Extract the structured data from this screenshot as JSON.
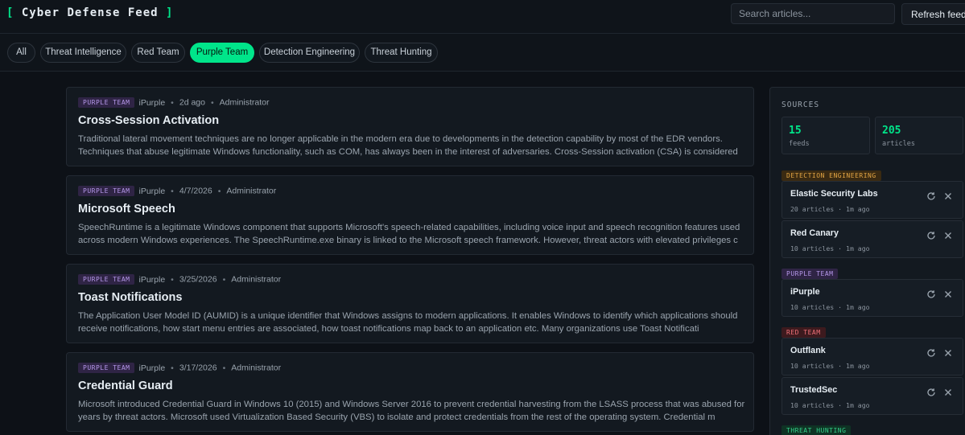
{
  "app": {
    "title_left": "[",
    "title": " Cyber Defense Feed ",
    "title_right": "]"
  },
  "header": {
    "search_placeholder": "Search articles...",
    "refresh_label": "Refresh feeds"
  },
  "tabs": [
    {
      "label": "All",
      "active": false
    },
    {
      "label": "Threat Intelligence",
      "active": false
    },
    {
      "label": "Red Team",
      "active": false
    },
    {
      "label": "Purple Team",
      "active": true
    },
    {
      "label": "Detection Engineering",
      "active": false
    },
    {
      "label": "Threat Hunting",
      "active": false
    }
  ],
  "articles": [
    {
      "tag": "PURPLE TEAM",
      "source": "iPurple",
      "date": "2d ago",
      "author": "Administrator",
      "title": "Cross-Session Activation",
      "summary": "Traditional lateral movement techniques are no longer applicable in the modern era due to developments in the detection capability by most of the EDR vendors. Techniques that abuse legitimate Windows functionality, such as COM, has always been in the interest of adversaries. Cross-Session activation (CSA) is considered"
    },
    {
      "tag": "PURPLE TEAM",
      "source": "iPurple",
      "date": "4/7/2026",
      "author": "Administrator",
      "title": "Microsoft Speech",
      "summary": "SpeechRuntime is a legitimate Windows component that supports Microsoft's speech-related capabilities, including voice input and speech recognition features used across modern Windows experiences. The SpeechRuntime.exe binary is linked to the Microsoft speech framework. However, threat actors with elevated privileges c"
    },
    {
      "tag": "PURPLE TEAM",
      "source": "iPurple",
      "date": "3/25/2026",
      "author": "Administrator",
      "title": "Toast Notifications",
      "summary": "The Application User Model ID (AUMID) is a unique identifier that Windows assigns to modern applications. It enables Windows to identify which applications should receive notifications, how start menu entries are associated, how toast notifications map back to an application etc. Many organizations use Toast Notificati"
    },
    {
      "tag": "PURPLE TEAM",
      "source": "iPurple",
      "date": "3/17/2026",
      "author": "Administrator",
      "title": "Credential Guard",
      "summary": "Microsoft introduced Credential Guard in Windows 10 (2015) and Windows Server 2016 to prevent credential harvesting from the LSASS process that was abused for years by threat actors. Microsoft used Virtualization Based Security (VBS) to isolate and protect credentials from the rest of the operating system. Credential m"
    }
  ],
  "sidebar": {
    "title": "SOURCES",
    "stats": [
      {
        "value": "15",
        "label": "feeds"
      },
      {
        "value": "205",
        "label": "articles"
      }
    ],
    "groups": [
      {
        "label": "DETECTION ENGINEERING",
        "color": "detection",
        "feeds": [
          {
            "name": "Elastic Security Labs",
            "meta": "20 articles · 1m ago"
          },
          {
            "name": "Red Canary",
            "meta": "10 articles · 1m ago"
          }
        ]
      },
      {
        "label": "PURPLE TEAM",
        "color": "purple",
        "feeds": [
          {
            "name": "iPurple",
            "meta": "10 articles · 1m ago"
          }
        ]
      },
      {
        "label": "RED TEAM",
        "color": "red",
        "feeds": [
          {
            "name": "Outflank",
            "meta": "10 articles · 1m ago"
          },
          {
            "name": "TrustedSec",
            "meta": "10 articles · 1m ago"
          }
        ]
      },
      {
        "label": "THREAT HUNTING",
        "color": "hunting",
        "feeds": []
      }
    ]
  },
  "icons": {
    "refresh": "refresh-icon",
    "remove": "close-icon"
  },
  "colors": {
    "accent": "#00e58a",
    "background": "#0d1117",
    "card": "#131920"
  }
}
